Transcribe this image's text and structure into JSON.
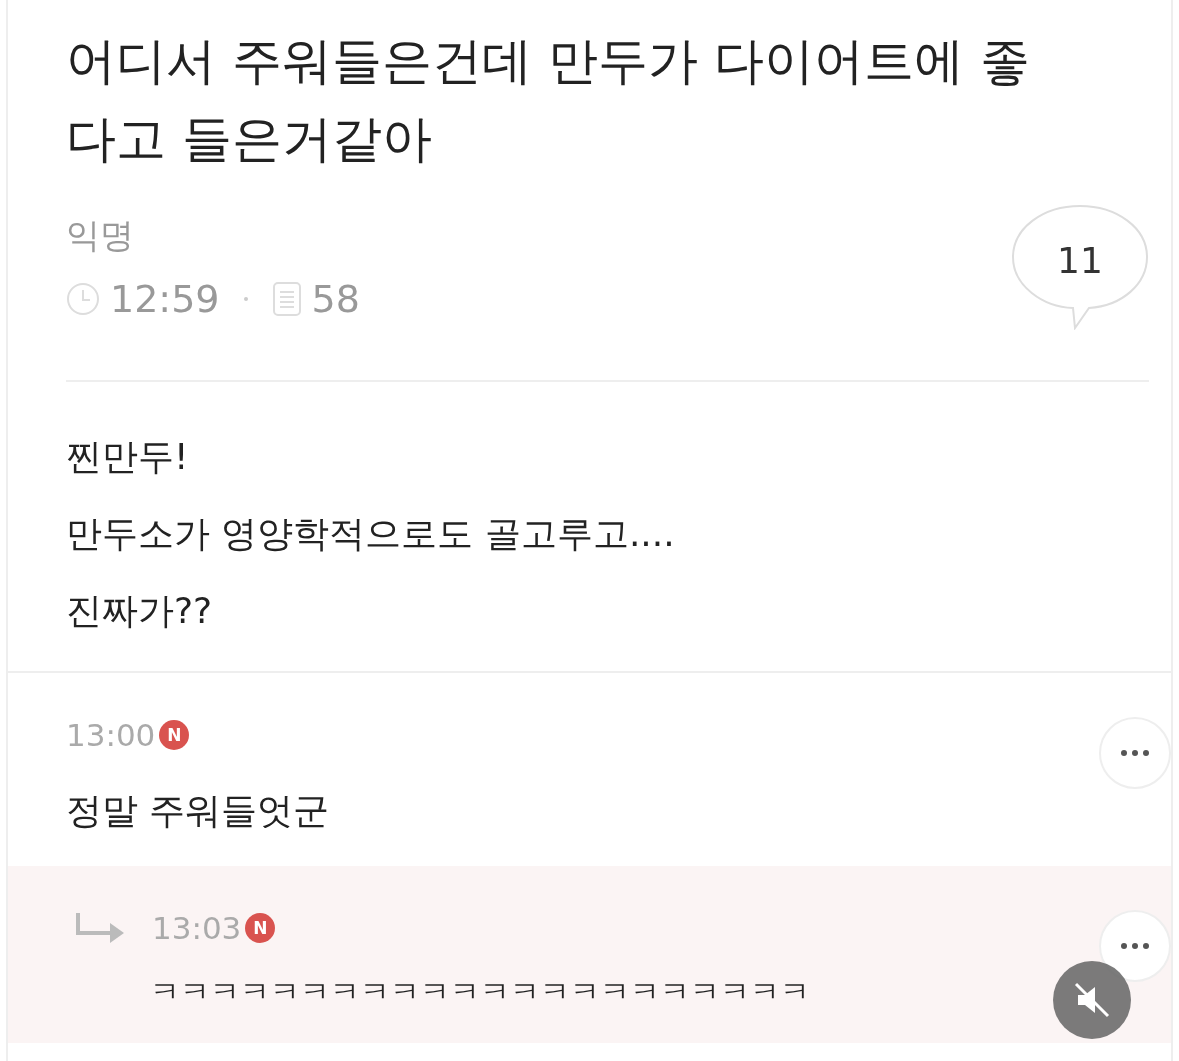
{
  "post": {
    "title": "어디서 주워들은건데 만두가 다이어트에 좋다고 들은거같아",
    "author": "익명",
    "time": "12:59",
    "views": "58",
    "comment_count": "11",
    "body": [
      "찐만두!",
      "만두소가 영양학적으로도 골고루고....",
      "진짜가??"
    ]
  },
  "comments": [
    {
      "kind": "comment",
      "time": "13:00",
      "badge": "N",
      "text": "정말 주워들엇군"
    },
    {
      "kind": "reply",
      "time": "13:03",
      "badge": "N",
      "text": "ㅋㅋㅋㅋㅋㅋㅋㅋㅋㅋㅋㅋㅋㅋㅋㅋㅋㅋㅋㅋㅋㅋ"
    }
  ],
  "video_overlay": {
    "muted": true
  }
}
